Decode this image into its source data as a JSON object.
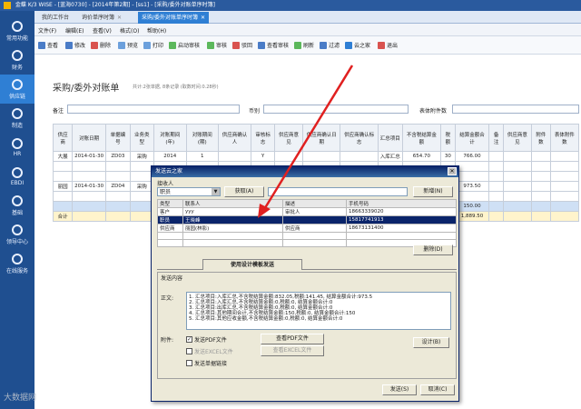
{
  "window": {
    "title": "金蝶 K/3 WISE - [蓝海0730] - [2014年第2期] - [ss1] - [采购/委外对账单序时簿]"
  },
  "sidebar": {
    "items": [
      {
        "label": "常用功能"
      },
      {
        "label": "财务"
      },
      {
        "label": "供应链"
      },
      {
        "label": "制造"
      },
      {
        "label": "HR"
      },
      {
        "label": "EBDI"
      },
      {
        "label": "基础"
      },
      {
        "label": "领导中心"
      },
      {
        "label": "在线服务"
      }
    ]
  },
  "tabs": [
    {
      "label": "我的工作台"
    },
    {
      "label": "询价单序时簿"
    },
    {
      "label": "采购/委外对账单序时簿"
    }
  ],
  "menus": [
    "文件(F)",
    "编辑(E)",
    "查看(V)",
    "格式(O)",
    "帮助(H)"
  ],
  "toolbar": [
    "查看",
    "修改",
    "删除",
    "预览",
    "打印",
    "启动审核",
    "审核",
    "驳回",
    "查看审核",
    "刷新",
    "过滤",
    "云之家",
    "退出"
  ],
  "page": {
    "title": "采购/委外对账单",
    "subtitle": "共计:2张单据, 8条记录 (取数时间:0.28秒)",
    "filters": {
      "note": "备注",
      "currency": "币别",
      "attachments": "表体附件数"
    }
  },
  "grid": {
    "headers": [
      "供应商",
      "对账日期",
      "单据编号",
      "业务类型",
      "对账期间(年)",
      "对账期间(期)",
      "供应商确认人",
      "审核标志",
      "供应商意见",
      "供应商确认日期",
      "供应商确认标志",
      "汇总项目",
      "不含税结算金额",
      "税额",
      "结算金额合计",
      "备注",
      "供应商意见",
      "附件数",
      "表体附件数"
    ],
    "rows": [
      [
        "大展",
        "2014-01-30",
        "ZD03",
        "采购",
        "2014",
        "1",
        "",
        "Y",
        "",
        "",
        "",
        "入库汇总",
        "654.70",
        "30",
        "766.00",
        "",
        "",
        "",
        ""
      ],
      [
        "",
        "",
        "",
        "",
        "",
        "",
        "",
        "",
        "",
        "",
        "",
        "",
        "",
        "",
        "",
        "",
        "",
        "",
        ""
      ],
      [
        "",
        "",
        "",
        "",
        "",
        "",
        "",
        "",
        "",
        "",
        "",
        "",
        "",
        "",
        "",
        "",
        "",
        "",
        ""
      ],
      [
        "丽园",
        "2014-01-30",
        "ZD04",
        "采购",
        "",
        "",
        "",
        "",
        "",
        "",
        "",
        "",
        "",
        "",
        "973.50",
        "",
        "",
        "",
        ""
      ],
      [
        "",
        "",
        "",
        "",
        "",
        "",
        "",
        "",
        "",
        "",
        "",
        "",
        "",
        "",
        "",
        "",
        "",
        "",
        ""
      ],
      [
        "",
        "",
        "",
        "",
        "",
        "",
        "",
        "",
        "",
        "",
        "",
        "",
        "",
        "",
        "150.00",
        "",
        "",
        "",
        ""
      ],
      [
        "合计",
        "",
        "",
        "",
        "",
        "",
        "",
        "",
        "",
        "",
        "",
        "",
        "",
        "",
        "1,889.50",
        "",
        "",
        "",
        ""
      ]
    ]
  },
  "dialog": {
    "title": "发送云之家",
    "receiver_label": "接收人",
    "type_select": "职员",
    "fetch_button": "获取(A)",
    "add_button": "新增(N)",
    "delete_button": "删除(D)",
    "recv_headers": [
      "类型",
      "联系人",
      "描述",
      "手机号码"
    ],
    "recv_rows": [
      [
        "客户",
        "yyy",
        "审批人",
        "18663339020"
      ],
      [
        "职员",
        "王晓峰",
        "",
        "15817741913"
      ],
      [
        "供应商",
        "丽园(林影)",
        "供应商",
        "18673131400"
      ]
    ],
    "section_tab": "使用设计模板发送",
    "send_content_label": "发送内容",
    "body_label": "正文:",
    "message_lines": [
      "1. 汇总项目:入库汇总,不含税结算金额:832.05,税额:141.45, 结算金额合计:973.5",
      "2. 汇总项目:入库汇总,不含税结算金额:0,税额:0, 结算金额合计:0",
      "3. 汇总项目:出库汇总,不含税结算金额:0,税额:0, 结算金额合计:0",
      "4. 汇总项目:其他期间合计,不含税结算金额:150,税额:0, 结算金额合计:150",
      "5. 汇总项目:其他应收金额,不含税结算金额:0,税额:0, 结算金额合计:0"
    ],
    "attachment_label": "附件:",
    "send_pdf": "发送PDF文件",
    "view_pdf": "查看PDF文件",
    "send_excel": "发送EXCEL文件",
    "view_excel": "查看EXCEL文件",
    "design_button": "设计(B)",
    "send_link": "发送单据链接",
    "send_button": "发送(S)",
    "cancel_button": "取消(C)"
  },
  "watermark": "大数据网"
}
